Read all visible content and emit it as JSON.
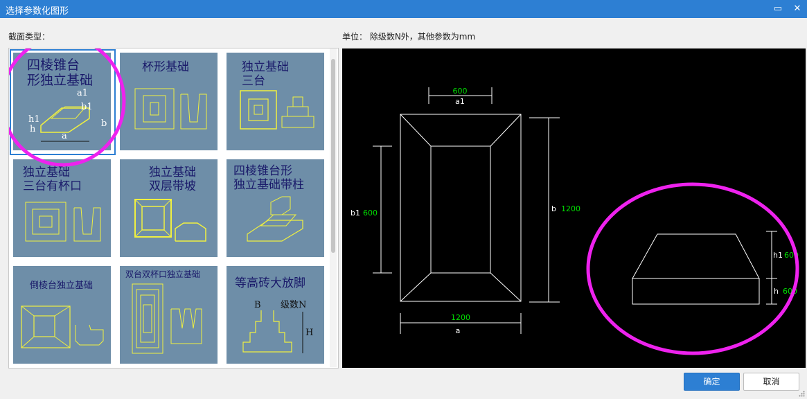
{
  "window": {
    "title": "选择参数化图形",
    "maximize_glyph": "▭",
    "close_glyph": "✕"
  },
  "section_label": "截面类型：",
  "units_label": "单位：  除级数N外，其他参数为mm",
  "thumbnails": [
    {
      "name": "四棱锥台形独立基础",
      "lines": [
        "四棱锥台",
        "形独立基础"
      ],
      "selected": true
    },
    {
      "name": "杯形基础",
      "lines": [
        "杯形基础"
      ],
      "selected": false
    },
    {
      "name": "独立基础三台",
      "lines": [
        "独立基础",
        "三台"
      ],
      "selected": false
    },
    {
      "name": "独立基础三台有杯口",
      "lines": [
        "独立基础",
        "三台有杯口"
      ],
      "selected": false
    },
    {
      "name": "独立基础双层带坡",
      "lines": [
        "独立基础",
        "双层带坡"
      ],
      "selected": false
    },
    {
      "name": "四棱锥台形独立基础带柱",
      "lines": [
        "四棱锥台形",
        "独立基础带柱"
      ],
      "selected": false
    },
    {
      "name": "倒棱台独立基础",
      "lines": [
        "倒棱台独立基础"
      ],
      "selected": false
    },
    {
      "name": "双台双杯口独立基础",
      "lines": [
        "双台双杯口独立基础"
      ],
      "selected": false
    },
    {
      "name": "等高砖大放脚",
      "lines": [
        "等高砖大放脚"
      ],
      "selected": false
    }
  ],
  "thumb_labels": {
    "t1": {
      "a1": "a1",
      "b1": "b1",
      "h1": "h1",
      "h": "h",
      "b": "b",
      "a": "a"
    },
    "t9": {
      "B": "B",
      "N": "级数N",
      "H": "H"
    }
  },
  "preview": {
    "a1_value": "600",
    "a1_label": "a1",
    "b1_label": "b1",
    "b1_value": "600",
    "b_label": "b",
    "b_value": "1200",
    "a_value": "1200",
    "a_label": "a",
    "h1_label": "h1",
    "h1_value": "600",
    "h_label": "h",
    "h_value": "600"
  },
  "buttons": {
    "ok": "确定",
    "cancel": "取消"
  },
  "colors": {
    "titlebar": "#2d7fd3",
    "thumb_bg": "#6e8ea8",
    "drawing_line": "#ffffff",
    "value_green": "#00e000",
    "highlight_magenta": "#ee22ee",
    "thumb_yellow": "#f0f040"
  }
}
